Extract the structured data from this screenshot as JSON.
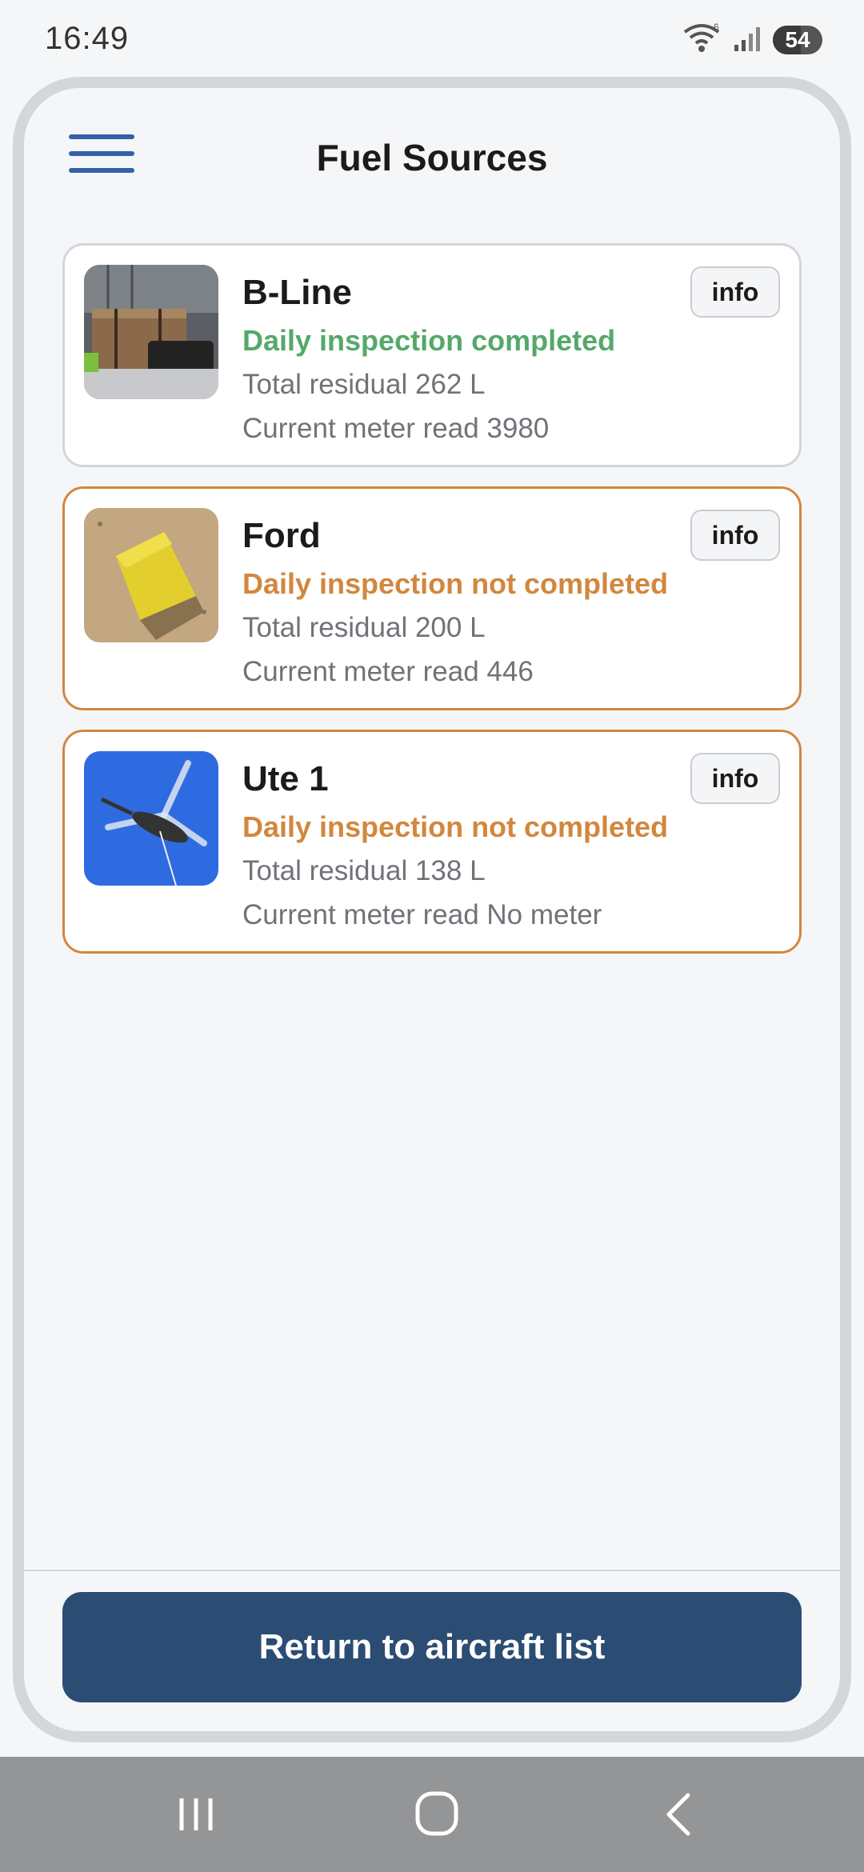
{
  "status_bar": {
    "time": "16:49",
    "wifi_icon": "wifi-icon",
    "signal_icon": "cell-signal-icon",
    "battery": "54"
  },
  "header": {
    "title": "Fuel Sources",
    "menu_icon": "hamburger-menu-icon"
  },
  "fuel_sources": [
    {
      "name": "B-Line",
      "status": "Daily inspection completed",
      "status_color": "#55a86a",
      "residual": "Total residual 262 L",
      "meter": "Current meter read 3980",
      "info_label": "info",
      "photo": "fuel-tank-crate-photo"
    },
    {
      "name": "Ford",
      "status": "Daily inspection not completed",
      "status_color": "#d2873e",
      "residual": "Total residual 200 L",
      "meter": "Current meter read 446",
      "info_label": "info",
      "photo": "yellow-fuel-container-photo"
    },
    {
      "name": "Ute 1",
      "status": "Daily inspection not completed",
      "status_color": "#d2873e",
      "residual": "Total residual 138 L",
      "meter": "Current meter read No meter",
      "info_label": "info",
      "photo": "helicopter-photo"
    }
  ],
  "footer": {
    "return_label": "Return to aircraft list",
    "button_color": "#2b4c73"
  },
  "nav_bar": {
    "recents_icon": "recents-icon",
    "home_icon": "home-icon",
    "back_icon": "back-icon"
  }
}
